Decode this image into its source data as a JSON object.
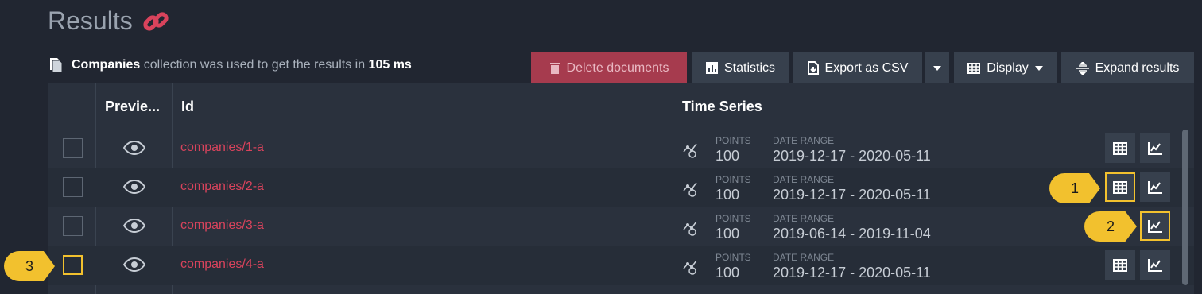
{
  "header": {
    "title": "Results",
    "collection_name": "Companies",
    "collection_word": "collection",
    "sentence_middle": "was used to get the results in",
    "duration": "105 ms"
  },
  "toolbar": {
    "delete_label": "Delete documents",
    "statistics_label": "Statistics",
    "export_label": "Export as CSV",
    "display_label": "Display",
    "expand_label": "Expand results"
  },
  "grid": {
    "columns": [
      "Previe...",
      "Id",
      "Time Series"
    ],
    "points_label": "POINTS",
    "date_range_label": "DATE RANGE",
    "rows": [
      {
        "id": "companies/1-a",
        "points": "100",
        "date_range": "2019-12-17 - 2020-05-11"
      },
      {
        "id": "companies/2-a",
        "points": "100",
        "date_range": "2019-12-17 - 2020-05-11"
      },
      {
        "id": "companies/3-a",
        "points": "100",
        "date_range": "2019-06-14 - 2019-11-04"
      },
      {
        "id": "companies/4-a",
        "points": "100",
        "date_range": "2019-12-17 - 2020-05-11"
      }
    ]
  },
  "callouts": [
    "1",
    "2",
    "3"
  ],
  "colors": {
    "background": "#212631",
    "grid": "#2a313d",
    "accent_red": "#d9435c",
    "danger_button": "#a63b4e",
    "highlight": "#f2c12e"
  },
  "icons": [
    "link-icon",
    "document-icon",
    "trash-icon",
    "bar-chart-icon",
    "export-icon",
    "table-icon",
    "expand-icon",
    "eye-icon",
    "timeseries-icon",
    "line-chart-icon"
  ]
}
